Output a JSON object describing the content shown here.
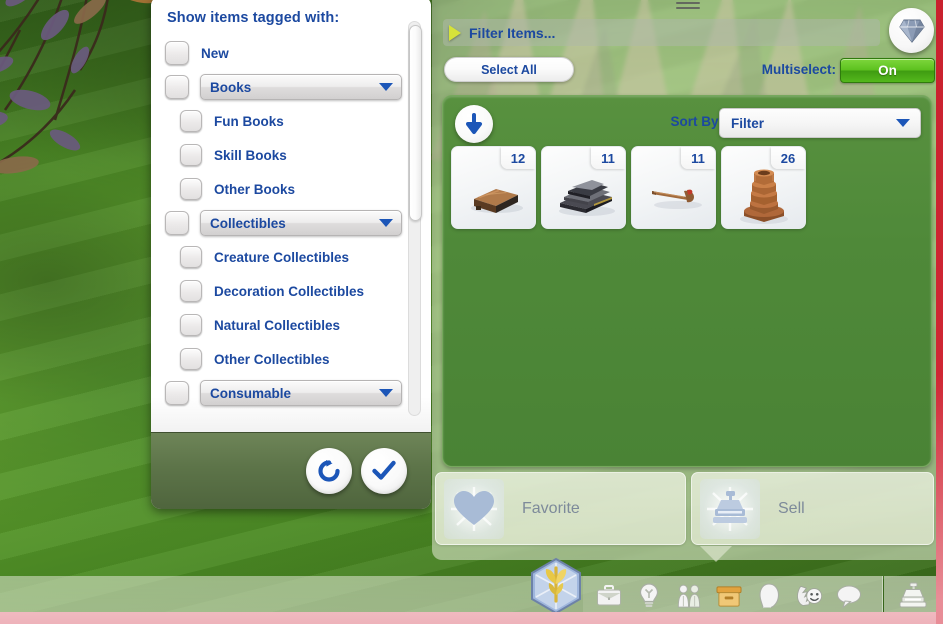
{
  "filter_dialog": {
    "title": "Show items tagged with:",
    "rows": [
      {
        "kind": "checkbox",
        "label": "New",
        "indent": 0,
        "checked": false
      },
      {
        "kind": "dropdown",
        "label": "Books",
        "indent": 0,
        "checked": false
      },
      {
        "kind": "checkbox",
        "label": "Fun Books",
        "indent": 1,
        "checked": false
      },
      {
        "kind": "checkbox",
        "label": "Skill Books",
        "indent": 1,
        "checked": false
      },
      {
        "kind": "checkbox",
        "label": "Other Books",
        "indent": 1,
        "checked": false
      },
      {
        "kind": "dropdown",
        "label": "Collectibles",
        "indent": 0,
        "checked": false
      },
      {
        "kind": "checkbox",
        "label": "Creature Collectibles",
        "indent": 1,
        "checked": false
      },
      {
        "kind": "checkbox",
        "label": "Decoration Collectibles",
        "indent": 1,
        "checked": false
      },
      {
        "kind": "checkbox",
        "label": "Natural Collectibles",
        "indent": 1,
        "checked": false
      },
      {
        "kind": "checkbox",
        "label": "Other Collectibles",
        "indent": 1,
        "checked": false
      },
      {
        "kind": "dropdown",
        "label": "Consumable",
        "indent": 0,
        "checked": false
      }
    ],
    "footer": {
      "reset_icon": "refresh-icon",
      "confirm_icon": "checkmark-icon"
    },
    "scrollbar": {
      "thumb_top_pct": 1,
      "thumb_height_pct": 50
    }
  },
  "inventory": {
    "drag_handle_icon": "drag-handle-icon",
    "filter_items_label": "Filter Items...",
    "filter_items_arrow_icon": "triangle-right-icon",
    "gem_icon": "diamond-icon",
    "select_all_label": "Select All",
    "multiselect_label": "Multiselect:",
    "multiselect_value": "On",
    "collapse_icon": "down-arrow-icon",
    "sort_by_label": "Sort By:",
    "sort_by_value": "Filter",
    "items": [
      {
        "name": "crate-item",
        "count": "12",
        "art": "crate"
      },
      {
        "name": "book-stack-item",
        "count": "11",
        "art": "books"
      },
      {
        "name": "tool-item",
        "count": "11",
        "art": "tool"
      },
      {
        "name": "copper-fitting-item",
        "count": "26",
        "art": "fitting"
      }
    ],
    "actions": [
      {
        "name": "favorite-button",
        "label": "Favorite",
        "icon": "heart-icon"
      },
      {
        "name": "sell-button",
        "label": "Sell",
        "icon": "cash-register-icon"
      }
    ]
  },
  "taskbar": {
    "plumbob_icon": "plumbob-icon",
    "icons": [
      {
        "name": "career-icon"
      },
      {
        "name": "lightbulb-icon"
      },
      {
        "name": "family-icon"
      },
      {
        "name": "inventory-box-icon"
      },
      {
        "name": "sim-head-icon"
      },
      {
        "name": "relationships-icon"
      },
      {
        "name": "speech-bubble-icon"
      }
    ],
    "register_icon": "cash-register-icon"
  },
  "colors": {
    "sims_blue": "#1c49a0",
    "panel_green": "#4f8939",
    "toggle_on_green": "#5cc11f",
    "accent_yellow": "#d6e23a"
  }
}
